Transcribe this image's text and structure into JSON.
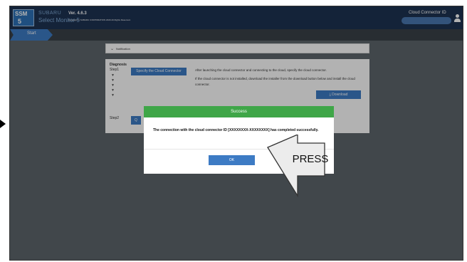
{
  "app": {
    "brand_line1": "SUBARU",
    "brand_line2": "Select Monitor 5",
    "logo_top": "SSM",
    "logo_bottom": "5",
    "version": "Ver. 4.6.3",
    "copyright": "Copyright © SUBARU CORPORATION 2020 All Rights Reserved."
  },
  "header": {
    "cloud_connector_label": "Cloud Connector ID"
  },
  "breadcrumb": {
    "start_label": "Start"
  },
  "notification": {
    "title": "Notification"
  },
  "diagnosis": {
    "title": "Diagnosis",
    "step1_label": "Step1",
    "step1_markers": "▼\n▼\n▼\n▼\n▼",
    "specify_button": "Specify the Cloud Connector",
    "description1": "After launching the cloud connector and connecting to the cloud, specify the cloud connector.",
    "description2": "If the cloud connector is not installed, download the installer from the download button below and install the cloud connector.",
    "download_button": "Download",
    "step2_label": "Step2",
    "step2_button": "Q"
  },
  "dialog": {
    "title": "Success",
    "message": "The connection with the cloud connector ID [XXXXXXXX-XXXXXXXX] has completed successfully.",
    "ok_button": "OK"
  },
  "annotation": {
    "press_label": "PRESS"
  }
}
